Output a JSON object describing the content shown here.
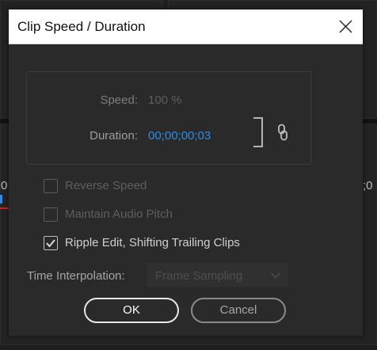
{
  "background": {
    "left_fragment": "0",
    "right_fragment": ";0"
  },
  "dialog": {
    "title": "Clip Speed / Duration",
    "close_icon": "close-icon",
    "speed": {
      "label": "Speed:",
      "value": "100 %"
    },
    "duration": {
      "label": "Duration:",
      "value": "00;00;00;03"
    },
    "link_icon": "chain-link-icon",
    "options": [
      {
        "label": "Reverse Speed",
        "checked": false,
        "enabled": false
      },
      {
        "label": "Maintain Audio Pitch",
        "checked": false,
        "enabled": false
      },
      {
        "label": "Ripple Edit, Shifting Trailing Clips",
        "checked": true,
        "enabled": true
      }
    ],
    "time_interpolation": {
      "label": "Time Interpolation:",
      "selected": "Frame Sampling"
    },
    "buttons": {
      "ok": "OK",
      "cancel": "Cancel"
    }
  },
  "colors": {
    "accent_blue": "#2d8ceb",
    "dialog_bg": "#2a2a2a",
    "timeline_marker": "#d42020"
  }
}
